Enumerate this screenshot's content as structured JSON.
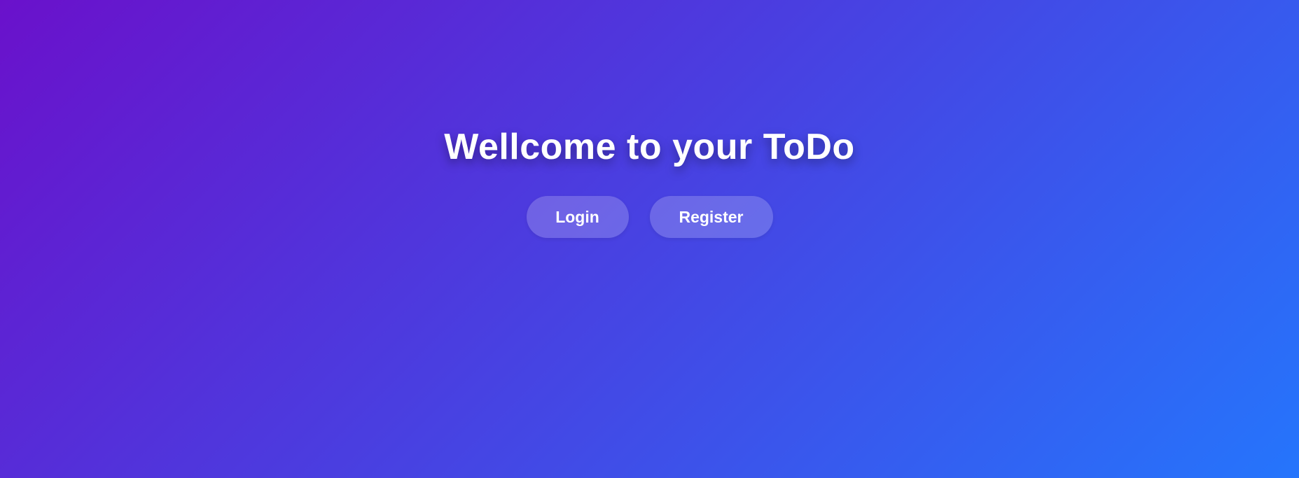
{
  "hero": {
    "title": "Wellcome to your ToDo"
  },
  "actions": {
    "login_label": "Login",
    "register_label": "Register"
  },
  "colors": {
    "gradient_start": "#6a11cb",
    "gradient_end": "#2575fc",
    "text": "#ffffff"
  }
}
